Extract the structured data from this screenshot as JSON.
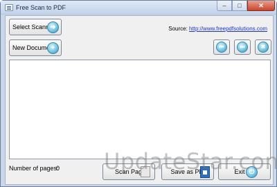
{
  "window": {
    "title": "Free Scan to PDF",
    "minimize_glyph": "–",
    "maximize_glyph": "□",
    "close_glyph": "✕"
  },
  "toolbar": {
    "select_scanner_label": "Select Scanner",
    "select_scanner_icon": "arrow-right-icon",
    "new_document_label": "New Document",
    "new_document_icon": "plus-icon",
    "source_label": "Source:",
    "source_link": "http://www.freepdfsolutions.com"
  },
  "navigation": {
    "previous_glyph": "⏮",
    "next_glyph": "⏭",
    "delete_glyph": "✖"
  },
  "footer": {
    "pages_label": "Number of pages:",
    "pages_count": "0",
    "scan_page_label": "Scan Page",
    "save_pdf_label": "Save as PDF",
    "exit_label": "Exit",
    "exit_icon": "power-icon"
  },
  "watermark": "UpdateStar.com",
  "colors": {
    "accent": "#3b87a8",
    "link": "#1d35c9",
    "close_button": "#c7452b"
  }
}
